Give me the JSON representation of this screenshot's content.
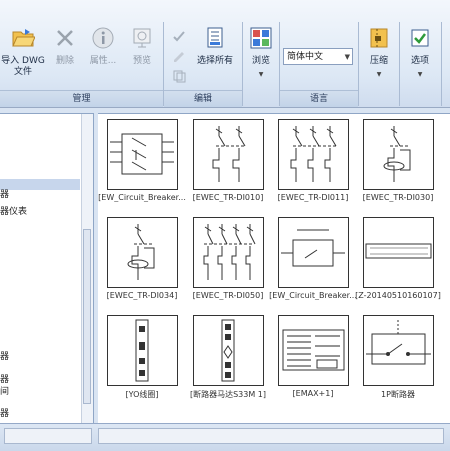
{
  "ribbon": {
    "buttons": {
      "import": "导入 DWG\n文件",
      "delete": "删除",
      "properties": "属性...",
      "preview": "预览",
      "select_all": "选择所有",
      "browse": "浏览",
      "compress": "压缩",
      "options": "选项"
    },
    "language": "简体中文",
    "groups": {
      "manage": "管理",
      "edit": "编辑",
      "language": "语言"
    }
  },
  "tree": {
    "items": [
      "器",
      "器仪表",
      "器",
      "器",
      "间",
      "器"
    ]
  },
  "thumbnails": [
    {
      "caption": "[EW_Circuit_Breaker..."
    },
    {
      "caption": "[EWEC_TR-DI010]"
    },
    {
      "caption": "[EWEC_TR-DI011]"
    },
    {
      "caption": "[EWEC_TR-DI030]"
    },
    {
      "caption": "[EWEC_TR-DI034]"
    },
    {
      "caption": "[EWEC_TR-DI050]"
    },
    {
      "caption": "[EW_Circuit_Breaker..."
    },
    {
      "caption": "[Z-20140510160107]"
    },
    {
      "caption": "[YO线圈]"
    },
    {
      "caption": "[断路器马达S33M 1]"
    },
    {
      "caption": "[EMAX+1]"
    },
    {
      "caption": "1P断路器"
    }
  ]
}
